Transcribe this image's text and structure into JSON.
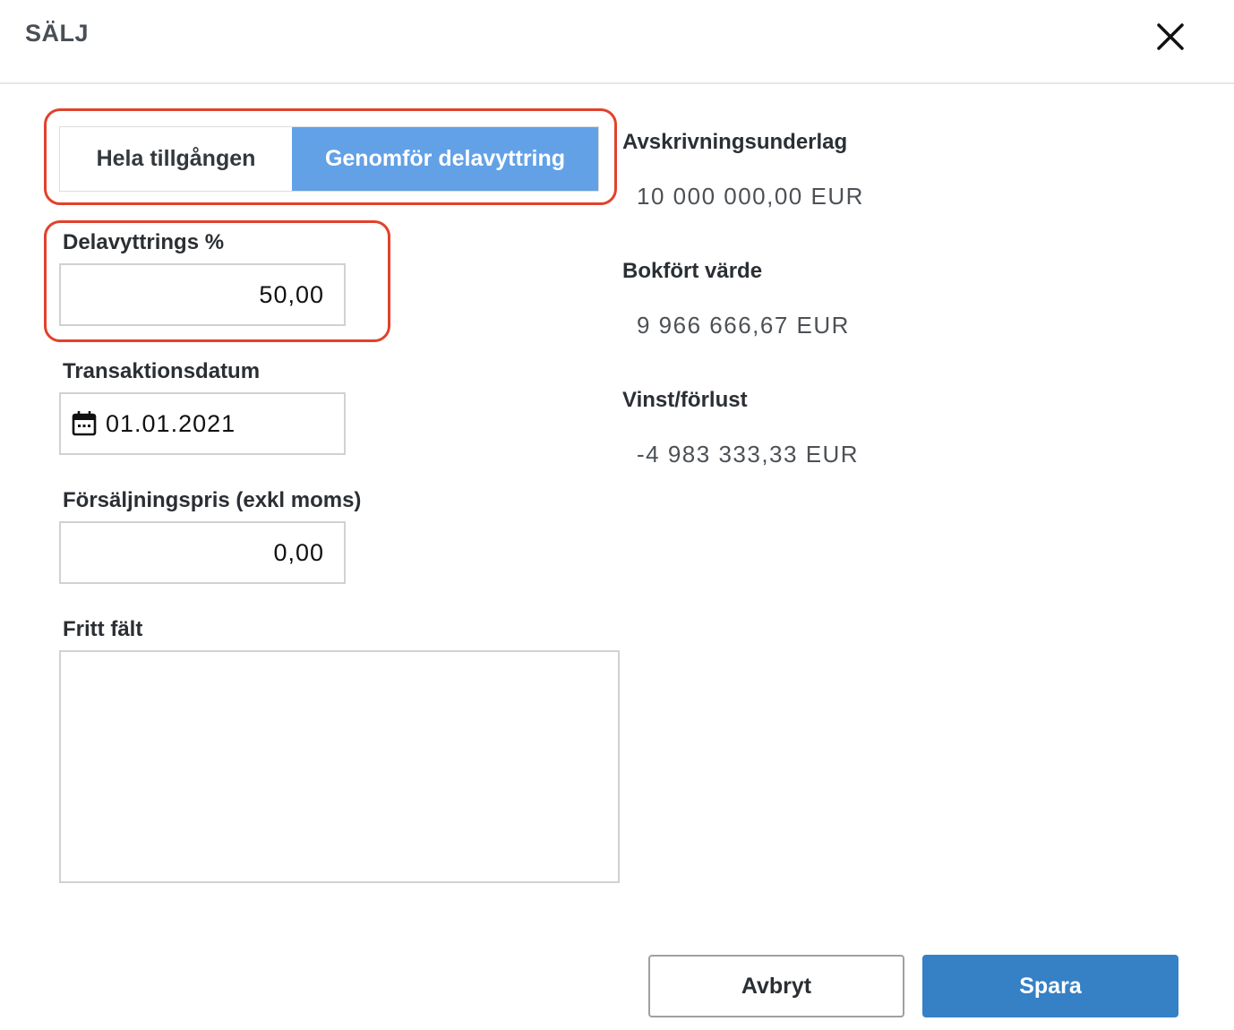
{
  "dialog": {
    "title": "SÄLJ",
    "close_icon": "close-icon"
  },
  "mode_toggle": {
    "options": [
      {
        "label": "Hela tillgången",
        "selected": false
      },
      {
        "label": "Genomför delavyttring",
        "selected": true
      }
    ],
    "active_color": "#63a1e6"
  },
  "form": {
    "partial_percent": {
      "label": "Delavyttrings %",
      "value": "50,00"
    },
    "transaction_date": {
      "label": "Transaktionsdatum",
      "value": "01.01.2021",
      "icon": "calendar-icon"
    },
    "sale_price": {
      "label": "Försäljningspris (exkl moms)",
      "value": "0,00"
    },
    "free_field": {
      "label": "Fritt fält",
      "value": ""
    }
  },
  "summary": {
    "depreciation_base": {
      "label": "Avskrivningsunderlag",
      "value": "10 000 000,00 EUR"
    },
    "book_value": {
      "label": "Bokfört värde",
      "value": "9 966 666,67 EUR"
    },
    "profit_loss": {
      "label": "Vinst/förlust",
      "value": "-4 983 333,33 EUR"
    }
  },
  "actions": {
    "cancel_label": "Avbryt",
    "save_label": "Spara",
    "save_color": "#3680c6"
  },
  "highlight_color": "#e2412b"
}
